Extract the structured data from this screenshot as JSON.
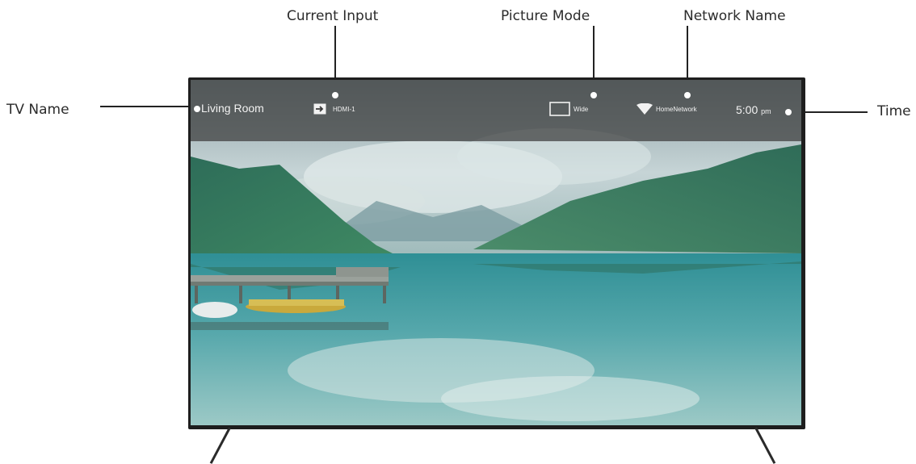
{
  "callouts": {
    "current_input": "Current Input",
    "picture_mode": "Picture Mode",
    "network_name": "Network Name",
    "tv_name": "TV Name",
    "time": "Time"
  },
  "status_bar": {
    "tv_name": "Living Room",
    "input": "HDMI-1",
    "input_icon": "input-arrow-icon",
    "picture_mode": "Wide",
    "picture_mode_icon": "aspect-ratio-icon",
    "network": "HomeNetwork",
    "network_icon": "wifi-icon",
    "time": "5:00",
    "time_suffix": "pm"
  }
}
